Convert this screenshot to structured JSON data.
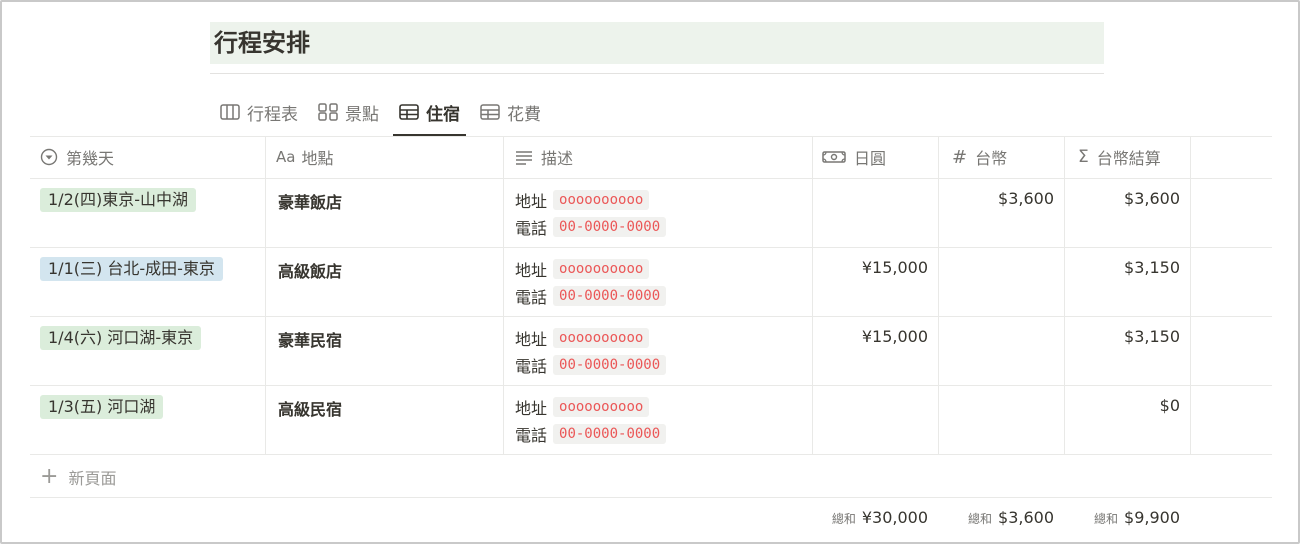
{
  "page": {
    "title": "行程安排"
  },
  "tabs": [
    {
      "label": "行程表",
      "icon": "board-icon",
      "active": false
    },
    {
      "label": "景點",
      "icon": "gallery-icon",
      "active": false
    },
    {
      "label": "住宿",
      "icon": "table-icon",
      "active": true
    },
    {
      "label": "花費",
      "icon": "table-icon",
      "active": false
    }
  ],
  "columns": [
    {
      "label": "第幾天",
      "icon": "select-icon"
    },
    {
      "label": "地點",
      "icon": "text-title-icon",
      "icon_text": "Aa"
    },
    {
      "label": "描述",
      "icon": "text-lines-icon"
    },
    {
      "label": "日圓",
      "icon": "money-icon"
    },
    {
      "label": "台幣",
      "icon": "number-icon",
      "icon_text": "#"
    },
    {
      "label": "台幣結算",
      "icon": "formula-icon",
      "icon_text": "Σ"
    }
  ],
  "rows": [
    {
      "day": "1/2(四)東京-山中湖",
      "day_color": "green",
      "place": "豪華飯店",
      "address_label": "地址",
      "address": "oooooooooo",
      "phone_label": "電話",
      "phone": "00-0000-0000",
      "jpy": "",
      "twd": "$3,600",
      "twd_total": "$3,600"
    },
    {
      "day": "1/1(三) 台北-成田-東京",
      "day_color": "blue",
      "place": "高級飯店",
      "address_label": "地址",
      "address": "oooooooooo",
      "phone_label": "電話",
      "phone": "00-0000-0000",
      "jpy": "¥15,000",
      "twd": "",
      "twd_total": "$3,150"
    },
    {
      "day": "1/4(六) 河口湖-東京",
      "day_color": "green",
      "place": "豪華民宿",
      "address_label": "地址",
      "address": "oooooooooo",
      "phone_label": "電話",
      "phone": "00-0000-0000",
      "jpy": "¥15,000",
      "twd": "",
      "twd_total": "$3,150"
    },
    {
      "day": "1/3(五) 河口湖",
      "day_color": "green",
      "place": "高級民宿",
      "address_label": "地址",
      "address": "oooooooooo",
      "phone_label": "電話",
      "phone": "00-0000-0000",
      "jpy": "",
      "twd": "",
      "twd_total": "$0"
    }
  ],
  "new_page_label": "新頁面",
  "sums": {
    "jpy": {
      "label": "總和",
      "value": "¥30,000"
    },
    "twd": {
      "label": "總和",
      "value": "$3,600"
    },
    "twd_total": {
      "label": "總和",
      "value": "$9,900"
    }
  },
  "colors": {
    "tag_green": "#dbeddb",
    "tag_blue": "#d3e5ef",
    "title_bg": "#edf3ec",
    "code_red": "#eb5757"
  }
}
